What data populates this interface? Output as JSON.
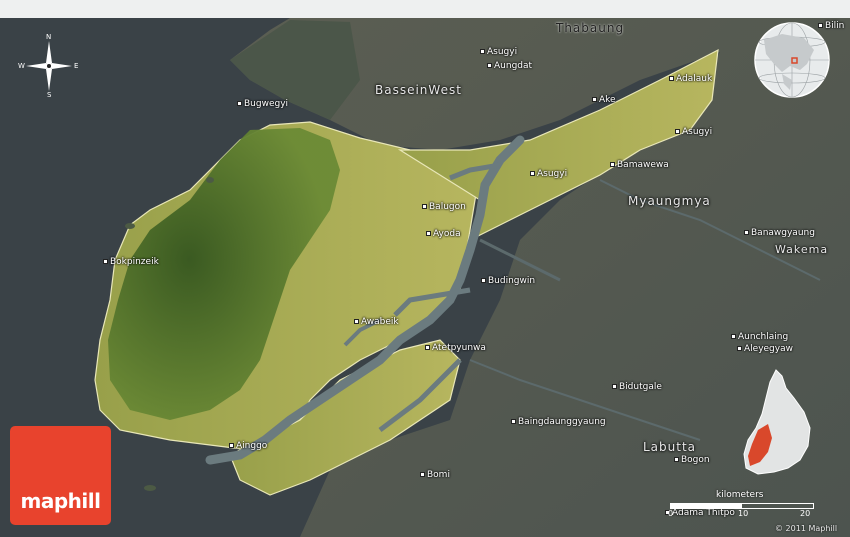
{
  "brand": {
    "logo_text": "maphill",
    "copyright": "© 2011 Maphill"
  },
  "compass": {
    "north": "N",
    "south": "S",
    "east": "E",
    "west": "W"
  },
  "colors": {
    "sea": "#3c4348",
    "highlight_land": "#a9ad55",
    "forest": "#4f7a2e",
    "river": "#6b7b7f",
    "logo": "#e8432d",
    "inset_region": "#d9482b"
  },
  "icons": {
    "compass": "compass-rose-icon",
    "globe": "locator-globe-icon",
    "inset": "region-locator-icon"
  },
  "regions": [
    {
      "id": "thabaung",
      "label": "Thabaung"
    },
    {
      "id": "bassein-west",
      "label": "BasseinWest"
    },
    {
      "id": "myaungmya",
      "label": "Myaungmya"
    },
    {
      "id": "labutta",
      "label": "Labutta"
    }
  ],
  "places": [
    {
      "id": "bilin",
      "label": "Bilin"
    },
    {
      "id": "asugyi-n",
      "label": "Asugyi"
    },
    {
      "id": "aungdat",
      "label": "Aungdat"
    },
    {
      "id": "bugwegyi",
      "label": "Bugwegyi"
    },
    {
      "id": "adalauk",
      "label": "Adalauk"
    },
    {
      "id": "ake",
      "label": "Ake"
    },
    {
      "id": "asugyi-e",
      "label": "Asugyi"
    },
    {
      "id": "bamawewa",
      "label": "Bamawewa"
    },
    {
      "id": "asugyi-c",
      "label": "Asugyi"
    },
    {
      "id": "balugon",
      "label": "Balugon"
    },
    {
      "id": "ayoda",
      "label": "Ayoda"
    },
    {
      "id": "banawgyaung",
      "label": "Banawgyaung"
    },
    {
      "id": "wakema",
      "label": "Wakema"
    },
    {
      "id": "bokpinzeik",
      "label": "Bokpinzeik"
    },
    {
      "id": "budingwin",
      "label": "Budingwin"
    },
    {
      "id": "awabeik",
      "label": "Awabeik"
    },
    {
      "id": "aunchlaing",
      "label": "Aunchlaing"
    },
    {
      "id": "aleyegyaw",
      "label": "Aleyegyaw"
    },
    {
      "id": "atetpyunwa",
      "label": "Atetpyunwa"
    },
    {
      "id": "bidutgale",
      "label": "Bidutgale"
    },
    {
      "id": "baingdaunggyaung",
      "label": "Baingdaunggyaung"
    },
    {
      "id": "bogon",
      "label": "Bogon"
    },
    {
      "id": "ainggo",
      "label": "Ainggo"
    },
    {
      "id": "bomi",
      "label": "Bomi"
    },
    {
      "id": "adama-thitpo",
      "label": "Adama Thitpo"
    }
  ],
  "scale": {
    "title": "kilometers",
    "ticks": [
      "0",
      "10",
      "20"
    ]
  }
}
